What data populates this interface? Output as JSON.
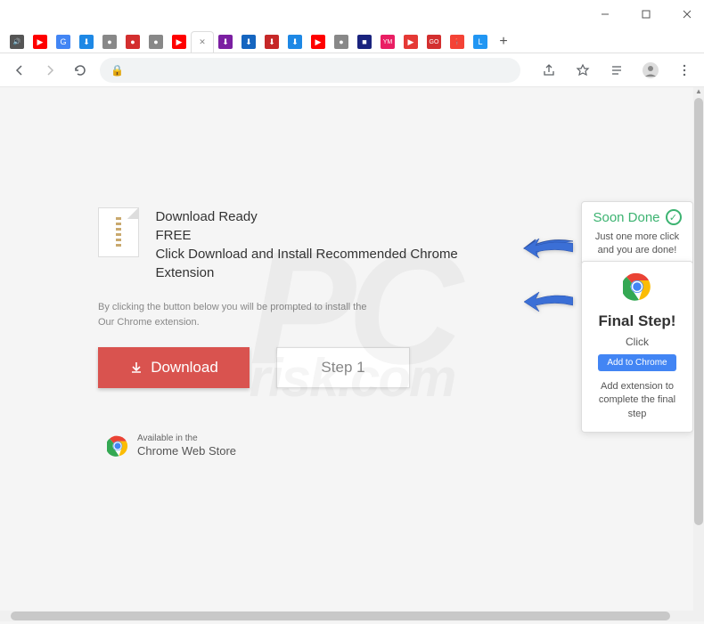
{
  "window": {
    "minimize": "–",
    "maximize": "▢",
    "close": "✕"
  },
  "tabs": {
    "items": [
      {
        "fav": "🔊",
        "color": "#555"
      },
      {
        "fav": "▶",
        "color": "#ff0000"
      },
      {
        "fav": "G",
        "color": "#4285f4"
      },
      {
        "fav": "⬇",
        "color": "#1e88e5"
      },
      {
        "fav": "●",
        "color": "#888"
      },
      {
        "fav": "●",
        "color": "#d32f2f"
      },
      {
        "fav": "●",
        "color": "#888"
      },
      {
        "fav": "▶",
        "color": "#ff0000"
      },
      {
        "fav": "✕",
        "color": "#888",
        "active": true
      },
      {
        "fav": "⬇",
        "color": "#7b1fa2"
      },
      {
        "fav": "⬇",
        "color": "#1565c0"
      },
      {
        "fav": "⬇",
        "color": "#c62828"
      },
      {
        "fav": "⬇",
        "color": "#1e88e5"
      },
      {
        "fav": "▶",
        "color": "#ff0000"
      },
      {
        "fav": "●",
        "color": "#888"
      },
      {
        "fav": "■",
        "color": "#1a237e"
      },
      {
        "fav": "YM",
        "color": "#e91e63"
      },
      {
        "fav": "▶",
        "color": "#e53935"
      },
      {
        "fav": "GO",
        "color": "#d32f2f"
      },
      {
        "fav": "📍",
        "color": "#f44336"
      },
      {
        "fav": "L",
        "color": "#2196f3"
      }
    ],
    "newtab": "+"
  },
  "toolbar": {
    "url_placeholder": ""
  },
  "page": {
    "headline1": "Download Ready",
    "headline2": "FREE",
    "headline3": "Click Download and Install Recommended Chrome Extension",
    "disclaimer1": "By clicking the button below you will be prompted to install the",
    "disclaimer2": "Our Chrome extension.",
    "download_btn": "Download",
    "step_btn": "Step 1",
    "store_avail": "Available in the",
    "store_name": "Chrome Web Store"
  },
  "popup_soon": {
    "title": "Soon Done",
    "text": "Just one more click and you are done!"
  },
  "popup_final": {
    "title": "Final Step!",
    "sub": "Click",
    "button": "Add to Chrome",
    "desc": "Add extension to complete the final step"
  },
  "watermark": {
    "main": "PC",
    "sub": "risk.com"
  }
}
